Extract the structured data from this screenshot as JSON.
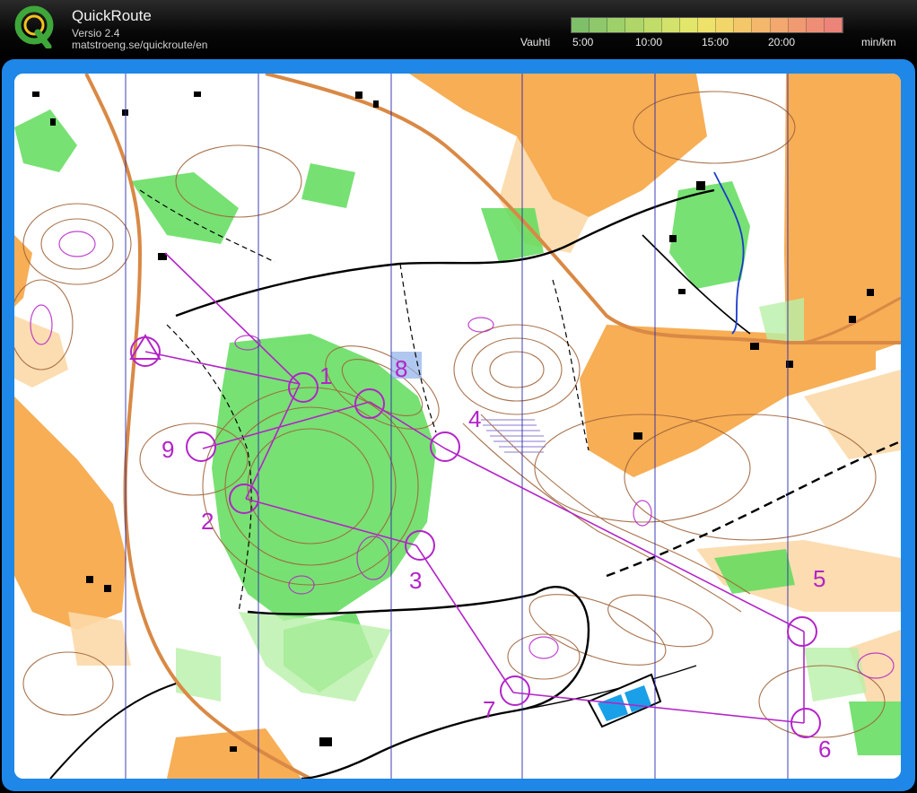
{
  "app": {
    "title": "QuickRoute",
    "version": "Versio 2.4",
    "url": "matstroeng.se/quickroute/en"
  },
  "pace_scale": {
    "label": "Vauhti",
    "unit": "min/km",
    "ticks": [
      "5:00",
      "10:00",
      "15:00",
      "20:00"
    ],
    "colors": [
      "#7fbf6a",
      "#8ec86a",
      "#9ed06a",
      "#b0d66a",
      "#c2dc6a",
      "#d3e26a",
      "#e2e66a",
      "#eee26a",
      "#f2d66a",
      "#f4c86a",
      "#f4b86c",
      "#f2a86e",
      "#f09a72",
      "#ee8e76",
      "#ec847a"
    ]
  },
  "map": {
    "control_labels": [
      "1",
      "2",
      "3",
      "4",
      "5",
      "6",
      "7",
      "8",
      "9"
    ],
    "colors": {
      "open_land": "#f7ae55",
      "rough_open": "#fcd9a8",
      "forest_green": "#5fdc5a",
      "contour": "#a0643a",
      "course": "#b324c8",
      "road": "#d98945",
      "meridian": "#2b2bb0"
    }
  }
}
